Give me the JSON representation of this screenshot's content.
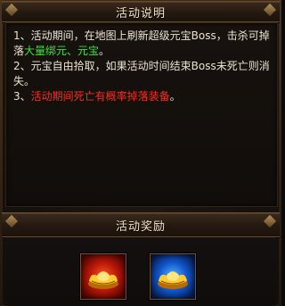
{
  "headers": {
    "description_title": "活动说明",
    "rewards_title": "活动奖励"
  },
  "description": {
    "line1_prefix": "1、活动期间，在地图上刷新超级元宝Boss，击杀可掉落",
    "line1_highlight": "大量绑元、元宝",
    "line1_suffix": "。",
    "line2": "2、元宝自由拾取，如果活动时间结束Boss未死亡则消失。",
    "line3_prefix": "3、",
    "line3_highlight": "活动期间死亡有概率掉落装备",
    "line3_suffix": "。"
  },
  "rewards": [
    {
      "icon": "gold-ingot-icon",
      "frame_color": "red"
    },
    {
      "icon": "gold-ingot-icon",
      "frame_color": "blue"
    }
  ],
  "colors": {
    "highlight_green": "#37e23a",
    "highlight_red": "#ff2a1a",
    "title_text": "#f2e3c2"
  }
}
